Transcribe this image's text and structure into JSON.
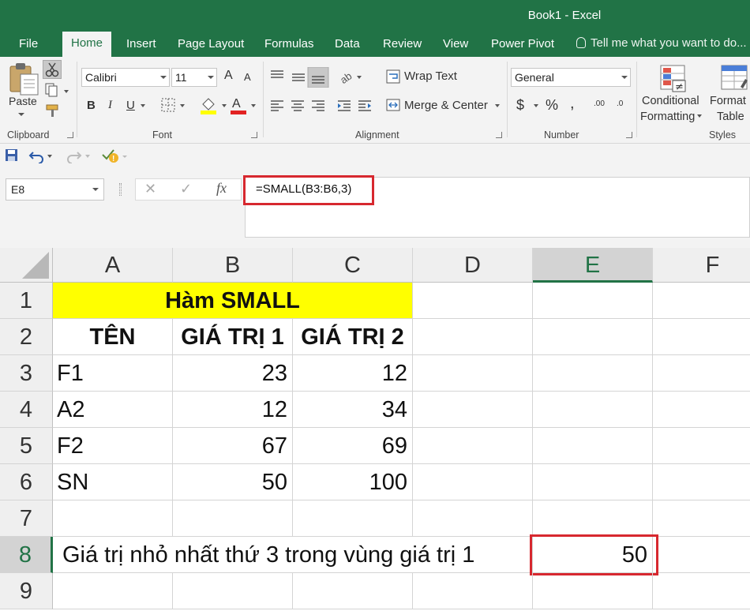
{
  "window": {
    "title": "Book1 - Excel"
  },
  "tabs": [
    "File",
    "Home",
    "Insert",
    "Page Layout",
    "Formulas",
    "Data",
    "Review",
    "View",
    "Power Pivot"
  ],
  "tell_me": "Tell me what you want to do...",
  "ribbon": {
    "clipboard": {
      "label": "Clipboard",
      "paste": "Paste"
    },
    "font": {
      "label": "Font",
      "name": "Calibri",
      "size": "11",
      "bold": "B",
      "italic": "I",
      "underline": "U",
      "grow": "A",
      "shrink": "A",
      "color_letter": "A"
    },
    "alignment": {
      "label": "Alignment",
      "wrap_text": "Wrap Text",
      "merge_center": "Merge & Center"
    },
    "number": {
      "label": "Number",
      "format": "General",
      "currency": "$",
      "percent": "%",
      "comma": ",",
      "inc_dec": ".00",
      "dec_dec": ".0"
    },
    "styles": {
      "label": "Styles",
      "conditional_1": "Conditional",
      "conditional_2": "Formatting",
      "format_1": "Format",
      "format_2": "Table"
    }
  },
  "formula_bar": {
    "name_box": "E8",
    "cancel": "✕",
    "enter": "✓",
    "fx": "fx",
    "formula": "=SMALL(B3:B6,3)"
  },
  "grid": {
    "columns": [
      "A",
      "B",
      "C",
      "D",
      "E",
      "F"
    ],
    "rows": [
      "1",
      "2",
      "3",
      "4",
      "5",
      "6",
      "7",
      "8",
      "9"
    ],
    "selected_col": "E",
    "selected_row": "8",
    "title": "Hàm SMALL",
    "headers": [
      "TÊN",
      "GIÁ TRỊ 1",
      "GIÁ TRỊ 2"
    ],
    "data": [
      {
        "name": "F1",
        "v1": "23",
        "v2": "12"
      },
      {
        "name": "A2",
        "v1": "12",
        "v2": "34"
      },
      {
        "name": "F2",
        "v1": "67",
        "v2": "69"
      },
      {
        "name": "SN",
        "v1": "50",
        "v2": "100"
      }
    ],
    "label_row8": "Giá trị nhỏ nhất thứ 3 trong vùng giá trị 1",
    "result": "50"
  },
  "colors": {
    "excel_green": "#217346",
    "highlight_red": "#d7282f",
    "title_fill": "#ffff00"
  }
}
